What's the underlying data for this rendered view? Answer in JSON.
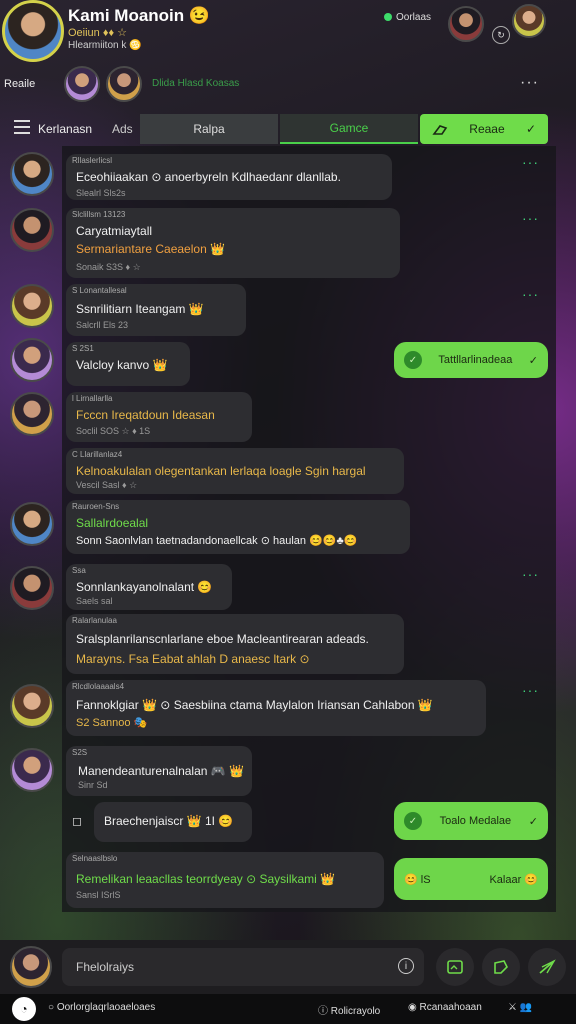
{
  "header": {
    "name": "Kami Moanoin 😉",
    "sub1": "Oeiiun ♦♦ ☆",
    "sub2": "Hlearmiiton k ♋",
    "status": "Oorlaas",
    "mini_icon": "↻",
    "label2": "Reaile",
    "label3": "Dlida Hlasd Koasas",
    "more": "···"
  },
  "tabs": {
    "label0": "Kerlanasn",
    "label1": "Ads",
    "groups": "Ralpa",
    "games": "Gamce",
    "active": "Reaae",
    "active_check": "✓"
  },
  "messages": [
    {
      "meta": "Rllaslerlicsl",
      "text": "Eceohiiaakan ⊙ anoerbyreln Kdlhaedanr dlanllab.",
      "sub": "Slealrl Sls2s"
    },
    {
      "meta": "Slclillsm 13123",
      "text": "Caryatmiaytall",
      "text2": "Sermariantare Caeaelon 👑",
      "sub": "Sonaik S3S ♦ ☆"
    },
    {
      "meta": "S Lonantallesal",
      "text": "Ssnrilitiarn Iteangam 👑",
      "sub": "Salcrll Els 23"
    },
    {
      "meta": "S 2S1",
      "text": "Valcloy kanvo 👑"
    },
    {
      "meta": "l Lirnallarlla",
      "text": "Fcccn Ireqatdoun Ideasan",
      "sub": "Soclil SOS ☆ ♦ 1S"
    },
    {
      "meta": "C Llarillanlaz4",
      "text": "Kelnoakulalan olegentankan lerlaqa loagle Sgin hargal",
      "sub": "Vescil Sasl ♦ ☆"
    },
    {
      "meta": "Rauroen-Sns",
      "text": "Sallalrdoealal",
      "text2": "Sonn Saonlvlan taetnadandonaellcak ⊙ haulan 😊😊♣😊",
      "sub": ""
    },
    {
      "meta": "Ssa",
      "text": "Sonnlankayanolnalant 😊",
      "sub": "Saels sal"
    },
    {
      "meta": "Ralarlanulaa",
      "text": "Sralsplanrilanscnlarlane eboe Macleantirearan adeads.",
      "text2": "Marayns. Fsa Eabat ahlah D anaesc ltark ⊙",
      "sub": ""
    },
    {
      "meta": "Rlcdlolaaaals4",
      "text": "Fannoklgiar 👑 ⊙ Saesbiina ctama Maylalon Iriansan Cahlabon 👑",
      "sub": "S2 Sannoo 🎭"
    },
    {
      "meta": "S2S",
      "text": "Manendeanturenalnalan 🎮 👑",
      "sub": "Sinr Sd"
    },
    {
      "meta": "",
      "text": "Braechenjaiscr 👑 1I 😊"
    },
    {
      "meta": "Selnaaslbslo",
      "text": "Remelikan leaacllas teorrdyeay ⊙ Saysilkami 👑",
      "sub": "Sansl ISrlS"
    }
  ],
  "green_bubbles": [
    {
      "text": "Tattllarlinadeaa",
      "check": "✓"
    },
    {
      "text": "Toalo Medalae",
      "check": "✓"
    },
    {
      "text": "Kalaar 😊",
      "prefix": "😊 lS"
    }
  ],
  "composer": {
    "placeholder": "Fhelolraiys",
    "info": "i"
  },
  "bottombar": {
    "home": "Q",
    "search": "Oorlorglaqrlaoaeloaes",
    "item2": "Rolicrayolo",
    "item3": "Rcanaahoaan",
    "icons": "⚔ 👥"
  }
}
